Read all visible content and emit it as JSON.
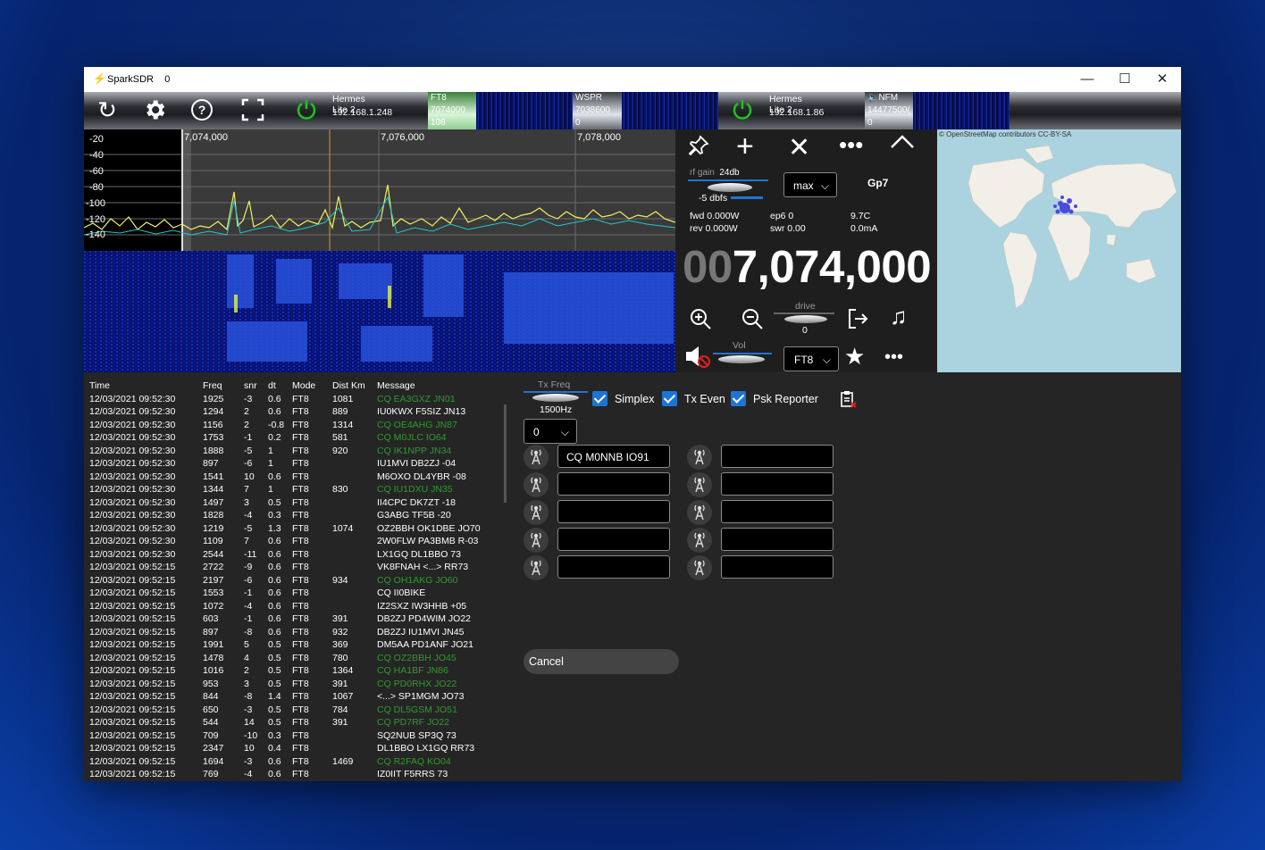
{
  "window": {
    "title": "SparkSDR",
    "count": "0"
  },
  "toolbar": {
    "receivers": [
      {
        "name": "Hermes Lite 2",
        "ip": "192.168.1.248"
      },
      {
        "name": "Hermes Lite 2",
        "ip": "192.168.1.86"
      }
    ],
    "slices": [
      {
        "mode": "FT8",
        "freq": "7074000",
        "extra": "108"
      },
      {
        "mode": "WSPR",
        "freq": "7038600",
        "extra": "0"
      },
      {
        "mode": "NFM",
        "freq": "14477500(",
        "extra": "0"
      }
    ]
  },
  "spectrum": {
    "db_labels": [
      "-20",
      "-40",
      "-60",
      "-80",
      "-100",
      "-120",
      "-140"
    ],
    "freq_labels": [
      "7,074,000",
      "7,076,000",
      "7,078,000"
    ]
  },
  "panel": {
    "rf_gain_label": "rf gain",
    "rf_gain_value": "24db",
    "dbfs": "-5 dbfs",
    "agc_value": "max",
    "locator": "Gp7",
    "fwd": "fwd 0.000W",
    "rev": "rev 0.000W",
    "ep6": "ep6 0",
    "swr": "swr 0.00",
    "temp": "9.7C",
    "current": "0.0mA",
    "freq_dim": "00",
    "freq_main": "7,074,000",
    "drive_label": "drive",
    "drive_value": "0",
    "vol_label": "Vol",
    "mode_value": "FT8"
  },
  "map": {
    "attribution": "© OpenStreetMap contributors CC-BY-SA"
  },
  "log": {
    "headers": [
      "Time",
      "Freq",
      "snr",
      "dt",
      "Mode",
      "Dist Km",
      "Message"
    ],
    "rows": [
      {
        "time": "12/03/2021 09:52:30",
        "freq": "1925",
        "snr": "-3",
        "dt": "0.6",
        "mode": "FT8",
        "dist": "1081",
        "msg": "CQ EA3GXZ JN01",
        "cq": true
      },
      {
        "time": "12/03/2021 09:52:30",
        "freq": "1294",
        "snr": "2",
        "dt": "0.6",
        "mode": "FT8",
        "dist": "889",
        "msg": "IU0KWX F5SIZ JN13",
        "cq": false
      },
      {
        "time": "12/03/2021 09:52:30",
        "freq": "1156",
        "snr": "2",
        "dt": "-0.8",
        "mode": "FT8",
        "dist": "1314",
        "msg": "CQ OE4AHG JN87",
        "cq": true
      },
      {
        "time": "12/03/2021 09:52:30",
        "freq": "1753",
        "snr": "-1",
        "dt": "0.2",
        "mode": "FT8",
        "dist": "581",
        "msg": "CQ M0JLC IO64",
        "cq": true
      },
      {
        "time": "12/03/2021 09:52:30",
        "freq": "1888",
        "snr": "-5",
        "dt": "1",
        "mode": "FT8",
        "dist": "920",
        "msg": "CQ IK1NPP JN34",
        "cq": true
      },
      {
        "time": "12/03/2021 09:52:30",
        "freq": "897",
        "snr": "-6",
        "dt": "1",
        "mode": "FT8",
        "dist": "",
        "msg": "IU1MVI DB2ZJ -04",
        "cq": false
      },
      {
        "time": "12/03/2021 09:52:30",
        "freq": "1541",
        "snr": "10",
        "dt": "0.6",
        "mode": "FT8",
        "dist": "",
        "msg": "M6OXO DL4YBR -08",
        "cq": false
      },
      {
        "time": "12/03/2021 09:52:30",
        "freq": "1344",
        "snr": "7",
        "dt": "1",
        "mode": "FT8",
        "dist": "830",
        "msg": "CQ IU1DXU JN35",
        "cq": true
      },
      {
        "time": "12/03/2021 09:52:30",
        "freq": "1497",
        "snr": "3",
        "dt": "0.5",
        "mode": "FT8",
        "dist": "",
        "msg": "II4CPC DK7ZT -18",
        "cq": false
      },
      {
        "time": "12/03/2021 09:52:30",
        "freq": "1828",
        "snr": "-4",
        "dt": "0.3",
        "mode": "FT8",
        "dist": "",
        "msg": "G3ABG TF5B -20",
        "cq": false
      },
      {
        "time": "12/03/2021 09:52:30",
        "freq": "1219",
        "snr": "-5",
        "dt": "1.3",
        "mode": "FT8",
        "dist": "1074",
        "msg": "OZ2BBH OK1DBE JO70",
        "cq": false
      },
      {
        "time": "12/03/2021 09:52:30",
        "freq": "1109",
        "snr": "7",
        "dt": "0.6",
        "mode": "FT8",
        "dist": "",
        "msg": "2W0FLW PA3BMB R-03",
        "cq": false
      },
      {
        "time": "12/03/2021 09:52:30",
        "freq": "2544",
        "snr": "-11",
        "dt": "0.6",
        "mode": "FT8",
        "dist": "",
        "msg": "LX1GQ DL1BBO 73",
        "cq": false
      },
      {
        "time": "12/03/2021 09:52:15",
        "freq": "2722",
        "snr": "-9",
        "dt": "0.6",
        "mode": "FT8",
        "dist": "",
        "msg": "VK8FNAH <...> RR73",
        "cq": false
      },
      {
        "time": "12/03/2021 09:52:15",
        "freq": "2197",
        "snr": "-6",
        "dt": "0.6",
        "mode": "FT8",
        "dist": "934",
        "msg": "CQ OH1AKG JO60",
        "cq": true
      },
      {
        "time": "12/03/2021 09:52:15",
        "freq": "1553",
        "snr": "-1",
        "dt": "0.6",
        "mode": "FT8",
        "dist": "",
        "msg": "CQ II0BIKE",
        "cq": false
      },
      {
        "time": "12/03/2021 09:52:15",
        "freq": "1072",
        "snr": "-4",
        "dt": "0.6",
        "mode": "FT8",
        "dist": "",
        "msg": "IZ2SXZ IW3HHB +05",
        "cq": false
      },
      {
        "time": "12/03/2021 09:52:15",
        "freq": "603",
        "snr": "-1",
        "dt": "0.6",
        "mode": "FT8",
        "dist": "391",
        "msg": "DB2ZJ PD4WIM JO22",
        "cq": false
      },
      {
        "time": "12/03/2021 09:52:15",
        "freq": "897",
        "snr": "-8",
        "dt": "0.6",
        "mode": "FT8",
        "dist": "932",
        "msg": "DB2ZJ IU1MVI JN45",
        "cq": false
      },
      {
        "time": "12/03/2021 09:52:15",
        "freq": "1991",
        "snr": "5",
        "dt": "0.5",
        "mode": "FT8",
        "dist": "369",
        "msg": "DM5AA PD1ANF JO21",
        "cq": false
      },
      {
        "time": "12/03/2021 09:52:15",
        "freq": "1478",
        "snr": "4",
        "dt": "0.5",
        "mode": "FT8",
        "dist": "780",
        "msg": "CQ OZ2BBH JO45",
        "cq": true
      },
      {
        "time": "12/03/2021 09:52:15",
        "freq": "1016",
        "snr": "2",
        "dt": "0.5",
        "mode": "FT8",
        "dist": "1364",
        "msg": "CQ HA1BF JN86",
        "cq": true
      },
      {
        "time": "12/03/2021 09:52:15",
        "freq": "953",
        "snr": "3",
        "dt": "0.5",
        "mode": "FT8",
        "dist": "391",
        "msg": "CQ PD0RHX JO22",
        "cq": true
      },
      {
        "time": "12/03/2021 09:52:15",
        "freq": "844",
        "snr": "-8",
        "dt": "1.4",
        "mode": "FT8",
        "dist": "1067",
        "msg": "<...> SP1MGM JO73",
        "cq": false
      },
      {
        "time": "12/03/2021 09:52:15",
        "freq": "650",
        "snr": "-3",
        "dt": "0.5",
        "mode": "FT8",
        "dist": "784",
        "msg": "CQ DL5GSM JO51",
        "cq": true
      },
      {
        "time": "12/03/2021 09:52:15",
        "freq": "544",
        "snr": "14",
        "dt": "0.5",
        "mode": "FT8",
        "dist": "391",
        "msg": "CQ PD7RF JO22",
        "cq": true
      },
      {
        "time": "12/03/2021 09:52:15",
        "freq": "709",
        "snr": "-10",
        "dt": "0.3",
        "mode": "FT8",
        "dist": "",
        "msg": "SQ2NUB SP3Q 73",
        "cq": false
      },
      {
        "time": "12/03/2021 09:52:15",
        "freq": "2347",
        "snr": "10",
        "dt": "0.4",
        "mode": "FT8",
        "dist": "",
        "msg": "DL1BBO LX1GQ RR73",
        "cq": false
      },
      {
        "time": "12/03/2021 09:52:15",
        "freq": "1694",
        "snr": "-3",
        "dt": "0.6",
        "mode": "FT8",
        "dist": "1469",
        "msg": "CQ R2FAQ KO04",
        "cq": true
      },
      {
        "time": "12/03/2021 09:52:15",
        "freq": "769",
        "snr": "-4",
        "dt": "0.6",
        "mode": "FT8",
        "dist": "",
        "msg": "IZ0IIT F5RRS 73",
        "cq": false
      }
    ]
  },
  "tx": {
    "freq_label": "Tx Freq",
    "freq_value": "1500Hz",
    "simplex": "Simplex",
    "tx_even": "Tx Even",
    "psk": "Psk Reporter",
    "slot_value": "0",
    "messages_left": [
      "CQ M0NNB IO91",
      "",
      "",
      "",
      ""
    ],
    "messages_right": [
      "",
      "",
      "",
      "",
      ""
    ],
    "cancel": "Cancel"
  },
  "colors": {
    "accent": "#1e74d6",
    "cq_green": "#2e9a2e",
    "trace": "#f0f060"
  }
}
